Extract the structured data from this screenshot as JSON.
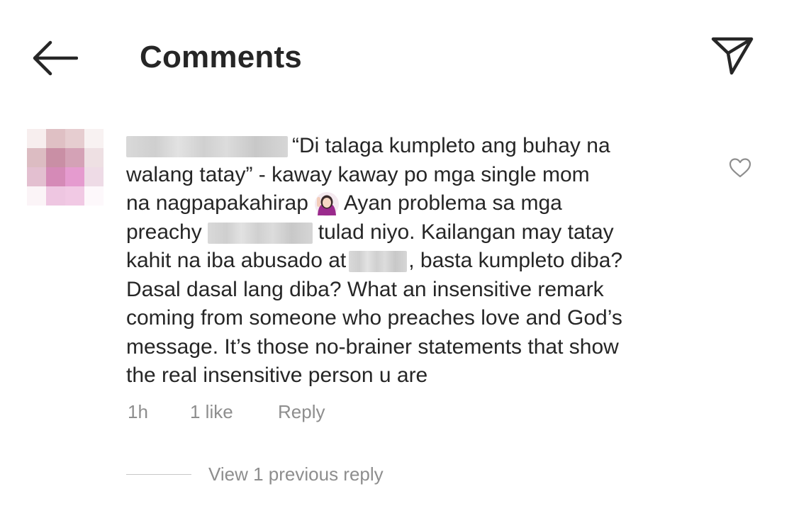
{
  "header": {
    "title": "Comments",
    "back_icon": "arrow-left-icon",
    "share_icon": "paper-plane-icon"
  },
  "comment": {
    "text_lines": {
      "line1": "“Di talaga kumpleto ang buhay na",
      "line2": "walang tatay” - kaway kaway po mga single mom",
      "line3a": "na nagpapakahirap",
      "line3b": "Ayan problema sa mga",
      "line4a": "preachy",
      "line4b": "tulad niyo. Kailangan may tatay",
      "line5a": "kahit na iba abusado at",
      "line5b": ", basta kumpleto diba?",
      "line6": "Dasal dasal lang diba? What an insensitive remark",
      "line7": "coming from someone who preaches love and God’s",
      "line8": "message. It’s those no-brainer statements that show",
      "line9": "the real insensitive person u are"
    },
    "emoji": "woman-raising-hand-emoji",
    "time": "1h",
    "likes": "1 like",
    "reply_label": "Reply",
    "view_replies": "View 1 previous reply",
    "like_icon": "heart-outline-icon"
  },
  "colors": {
    "text": "#262626",
    "secondary_text": "#8e8e8e",
    "divider": "#c7c7c7",
    "avatar_pink": "#d98fc0"
  }
}
